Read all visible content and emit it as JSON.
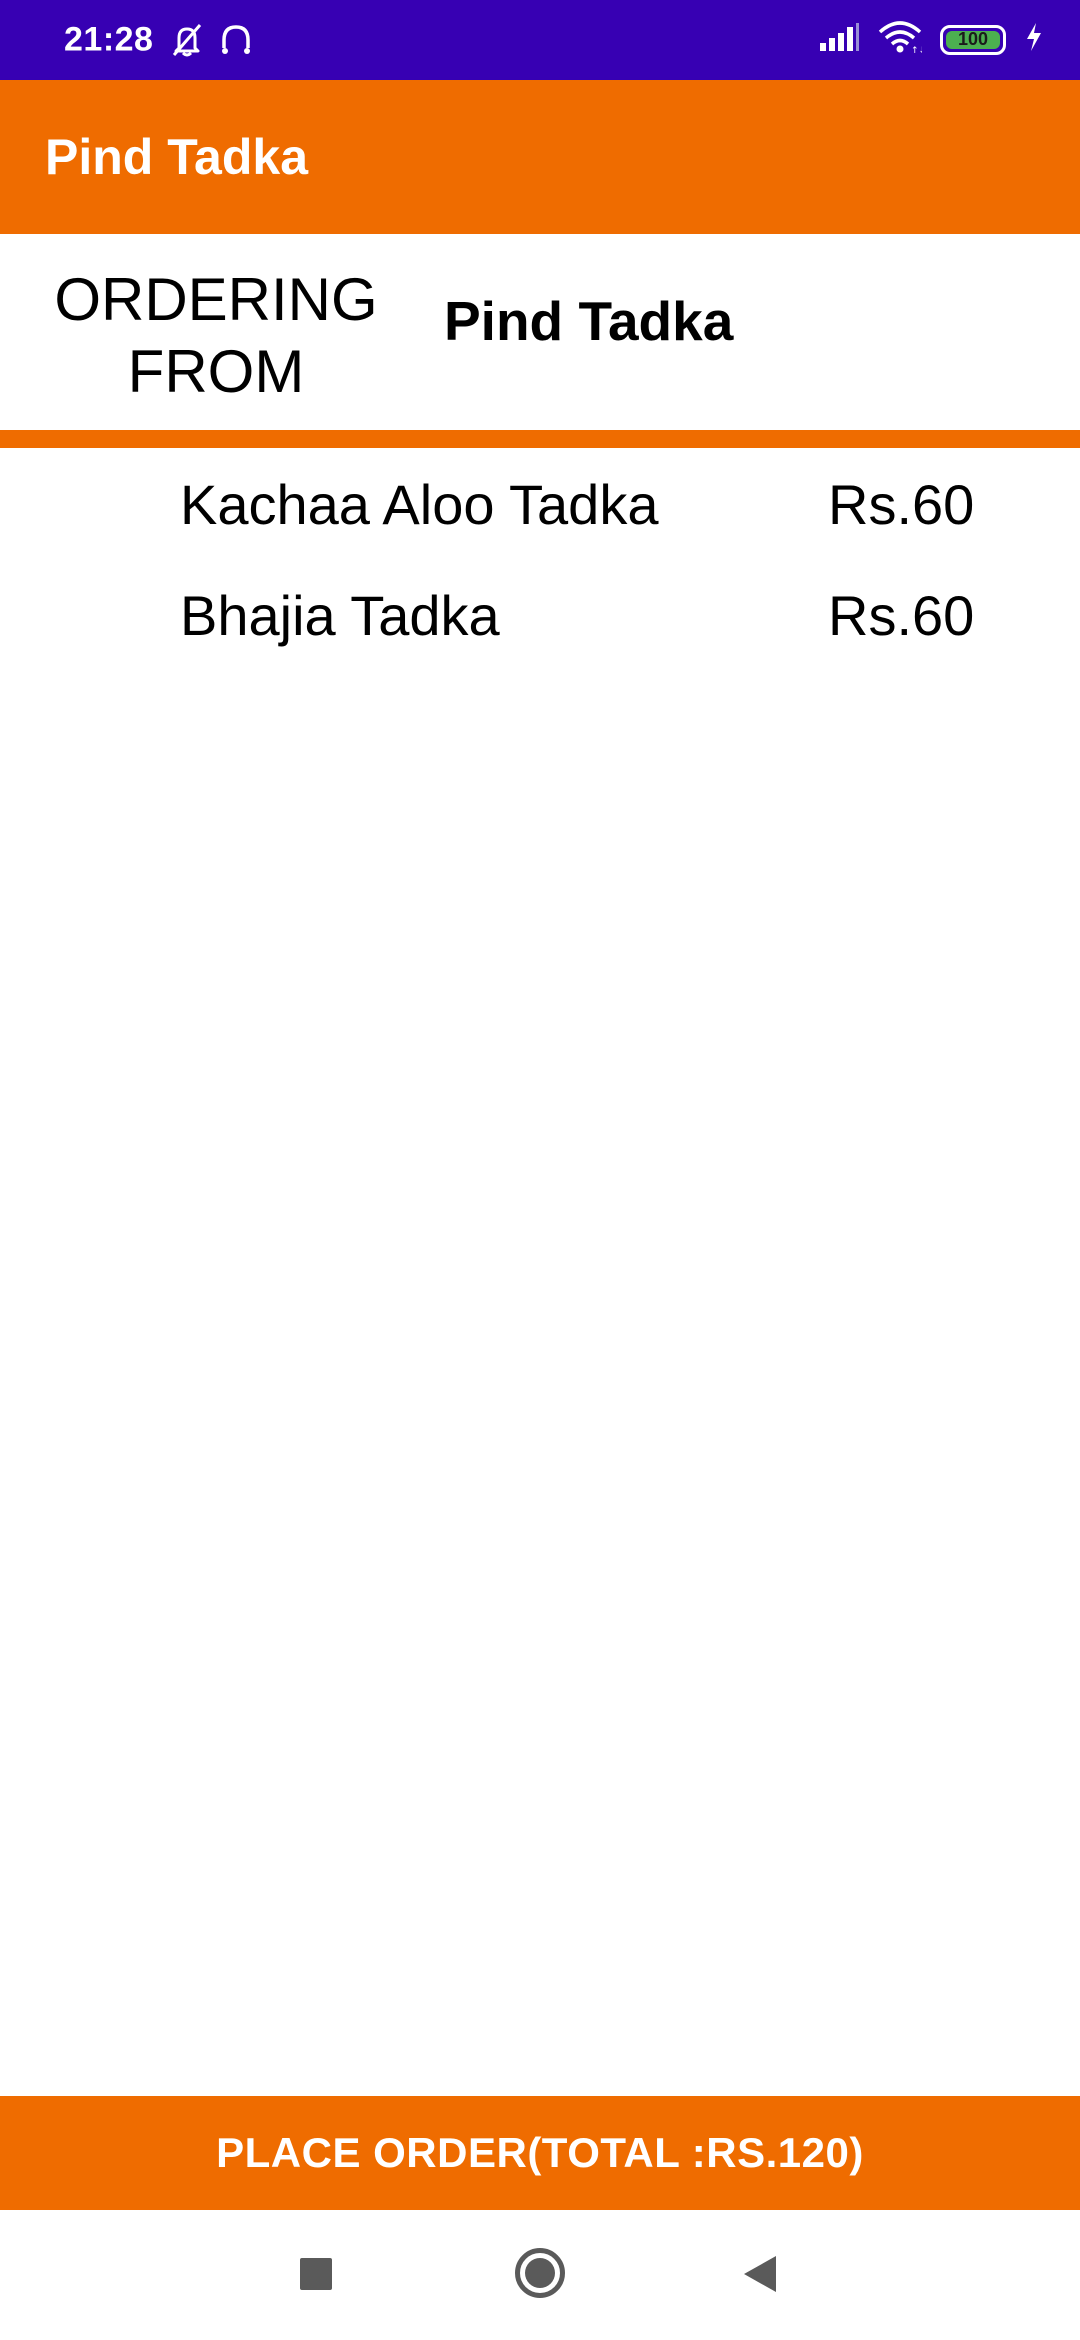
{
  "status_bar": {
    "time": "21:28",
    "battery_level": "100",
    "icons": [
      "bell-off-icon",
      "headphones-icon",
      "signal-icon",
      "wifi-icon",
      "battery-icon",
      "charging-icon"
    ]
  },
  "app_bar": {
    "title": "Pind Tadka"
  },
  "ordering": {
    "label": "ORDERING FROM",
    "restaurant": "Pind Tadka"
  },
  "items": [
    {
      "name": "Kachaa Aloo Tadka",
      "price": "Rs.60"
    },
    {
      "name": "Bhajia Tadka",
      "price": "Rs.60"
    }
  ],
  "place_order_label": "PLACE ORDER(TOTAL :RS.120)",
  "colors": {
    "status_bar": "#3700B3",
    "primary": "#EF6C00",
    "background": "#FFFFFF",
    "text": "#000000"
  },
  "nav_bar": {
    "icons": [
      "recent-apps-icon",
      "home-icon",
      "back-icon"
    ]
  }
}
